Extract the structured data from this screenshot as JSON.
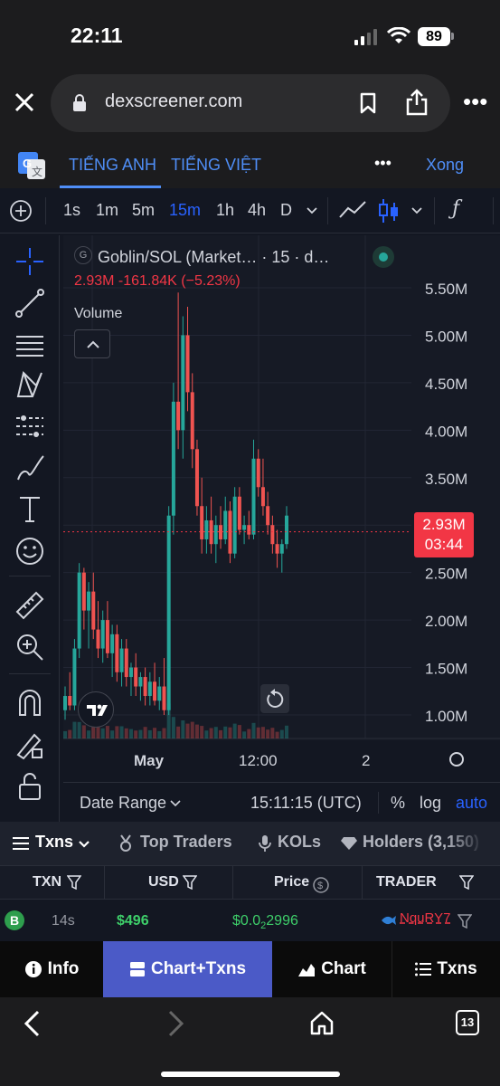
{
  "status_bar": {
    "time": "22:11",
    "battery": "89"
  },
  "browser": {
    "url": "dexscreener.com"
  },
  "translate": {
    "lang_from": "TIẾNG ANH",
    "lang_to": "TIẾNG VIỆT",
    "done": "Xong"
  },
  "toolbar": {
    "timeframes": [
      "1s",
      "1m",
      "5m",
      "15m",
      "1h",
      "4h",
      "D"
    ],
    "active_timeframe": "15m"
  },
  "legend": {
    "icon_letter": "G",
    "title": "Goblin/SOL (Market… · 15 · d…",
    "values": "2.93M  -161.84K (−5.23%)",
    "volume": "Volume"
  },
  "price_badge": {
    "price": "2.93M",
    "countdown": "03:44"
  },
  "chart_data": {
    "type": "candlestick",
    "title": "Goblin/SOL (Market… · 15 · d…",
    "y_tick_labels": [
      "5.50M",
      "5.00M",
      "4.50M",
      "4.00M",
      "3.50M",
      "2.50M",
      "2.00M",
      "1.50M",
      "1.00M"
    ],
    "x_tick_labels": [
      "May",
      "12:00",
      "2"
    ],
    "ylim": [
      0.8,
      5.75
    ],
    "last_price": 2.93,
    "change": "-161.84K",
    "change_pct": "−5.23%",
    "colors": {
      "up": "#26a69a",
      "down": "#ef5350"
    },
    "candles": [
      {
        "o": 1.05,
        "h": 1.3,
        "l": 0.95,
        "c": 1.2
      },
      {
        "o": 1.2,
        "h": 1.45,
        "l": 1.05,
        "c": 1.1
      },
      {
        "o": 1.1,
        "h": 1.8,
        "l": 1.05,
        "c": 1.7
      },
      {
        "o": 1.7,
        "h": 2.6,
        "l": 1.6,
        "c": 2.5
      },
      {
        "o": 2.5,
        "h": 2.55,
        "l": 1.9,
        "c": 2.1
      },
      {
        "o": 2.1,
        "h": 2.4,
        "l": 1.7,
        "c": 2.3
      },
      {
        "o": 2.3,
        "h": 2.5,
        "l": 1.8,
        "c": 1.9
      },
      {
        "o": 1.9,
        "h": 2.2,
        "l": 1.6,
        "c": 1.7
      },
      {
        "o": 1.7,
        "h": 2.1,
        "l": 1.55,
        "c": 2.0
      },
      {
        "o": 2.0,
        "h": 2.2,
        "l": 1.6,
        "c": 1.65
      },
      {
        "o": 1.65,
        "h": 1.95,
        "l": 1.4,
        "c": 1.85
      },
      {
        "o": 1.85,
        "h": 1.95,
        "l": 1.35,
        "c": 1.45
      },
      {
        "o": 1.45,
        "h": 1.8,
        "l": 1.3,
        "c": 1.7
      },
      {
        "o": 1.7,
        "h": 1.8,
        "l": 1.3,
        "c": 1.4
      },
      {
        "o": 1.4,
        "h": 1.55,
        "l": 1.2,
        "c": 1.5
      },
      {
        "o": 1.5,
        "h": 1.65,
        "l": 1.2,
        "c": 1.3
      },
      {
        "o": 1.3,
        "h": 1.45,
        "l": 1.15,
        "c": 1.4
      },
      {
        "o": 1.4,
        "h": 1.5,
        "l": 1.1,
        "c": 1.2
      },
      {
        "o": 1.2,
        "h": 1.45,
        "l": 1.1,
        "c": 1.35
      },
      {
        "o": 1.35,
        "h": 1.55,
        "l": 1.1,
        "c": 1.15
      },
      {
        "o": 1.15,
        "h": 1.4,
        "l": 1.05,
        "c": 1.3
      },
      {
        "o": 1.3,
        "h": 1.6,
        "l": 1.0,
        "c": 1.05
      },
      {
        "o": 1.05,
        "h": 3.2,
        "l": 1.0,
        "c": 3.1
      },
      {
        "o": 3.1,
        "h": 4.5,
        "l": 2.9,
        "c": 4.3
      },
      {
        "o": 4.3,
        "h": 5.45,
        "l": 3.8,
        "c": 4.0
      },
      {
        "o": 4.0,
        "h": 5.2,
        "l": 3.7,
        "c": 5.0
      },
      {
        "o": 5.0,
        "h": 5.3,
        "l": 4.2,
        "c": 4.4
      },
      {
        "o": 4.4,
        "h": 4.6,
        "l": 3.6,
        "c": 3.8
      },
      {
        "o": 3.8,
        "h": 3.9,
        "l": 3.1,
        "c": 3.2
      },
      {
        "o": 3.2,
        "h": 3.5,
        "l": 2.7,
        "c": 2.85
      },
      {
        "o": 2.85,
        "h": 3.2,
        "l": 2.7,
        "c": 3.05
      },
      {
        "o": 3.05,
        "h": 3.3,
        "l": 2.7,
        "c": 2.8
      },
      {
        "o": 2.8,
        "h": 3.1,
        "l": 2.6,
        "c": 3.0
      },
      {
        "o": 3.0,
        "h": 3.2,
        "l": 2.75,
        "c": 2.85
      },
      {
        "o": 2.85,
        "h": 3.3,
        "l": 2.8,
        "c": 3.15
      },
      {
        "o": 3.15,
        "h": 3.25,
        "l": 2.6,
        "c": 2.7
      },
      {
        "o": 2.7,
        "h": 3.4,
        "l": 2.65,
        "c": 3.3
      },
      {
        "o": 3.3,
        "h": 3.4,
        "l": 2.9,
        "c": 2.95
      },
      {
        "o": 2.95,
        "h": 3.1,
        "l": 2.8,
        "c": 3.0
      },
      {
        "o": 3.0,
        "h": 3.15,
        "l": 2.85,
        "c": 2.9
      },
      {
        "o": 2.9,
        "h": 3.9,
        "l": 2.85,
        "c": 3.7
      },
      {
        "o": 3.7,
        "h": 3.8,
        "l": 3.3,
        "c": 3.4
      },
      {
        "o": 3.4,
        "h": 3.7,
        "l": 3.1,
        "c": 3.2
      },
      {
        "o": 3.2,
        "h": 3.35,
        "l": 2.9,
        "c": 3.0
      },
      {
        "o": 3.0,
        "h": 3.1,
        "l": 2.7,
        "c": 2.8
      },
      {
        "o": 2.8,
        "h": 2.95,
        "l": 2.55,
        "c": 2.7
      },
      {
        "o": 2.7,
        "h": 2.85,
        "l": 2.5,
        "c": 2.8
      },
      {
        "o": 2.8,
        "h": 3.2,
        "l": 2.75,
        "c": 3.1
      }
    ]
  },
  "date_range": {
    "label": "Date Range",
    "time": "15:11:15 (UTC)",
    "percent": "%",
    "log": "log",
    "auto": "auto"
  },
  "tabs": {
    "txns": "Txns",
    "top_traders": "Top Traders",
    "kols": "KOLs",
    "holders": "Holders (3,150)"
  },
  "table": {
    "headers": [
      "TXN",
      "USD",
      "Price",
      "TRADER"
    ],
    "row": {
      "type": "B",
      "age": "14s",
      "usd": "$496",
      "price_prefix": "$0.0",
      "price_sub": "2",
      "price_rest": "2996",
      "trader": "NquRY7"
    }
  },
  "bottom_nav": {
    "info": "Info",
    "chart_txns": "Chart+Txns",
    "chart": "Chart",
    "txns": "Txns"
  },
  "browser_nav": {
    "tabs_count": "13"
  }
}
